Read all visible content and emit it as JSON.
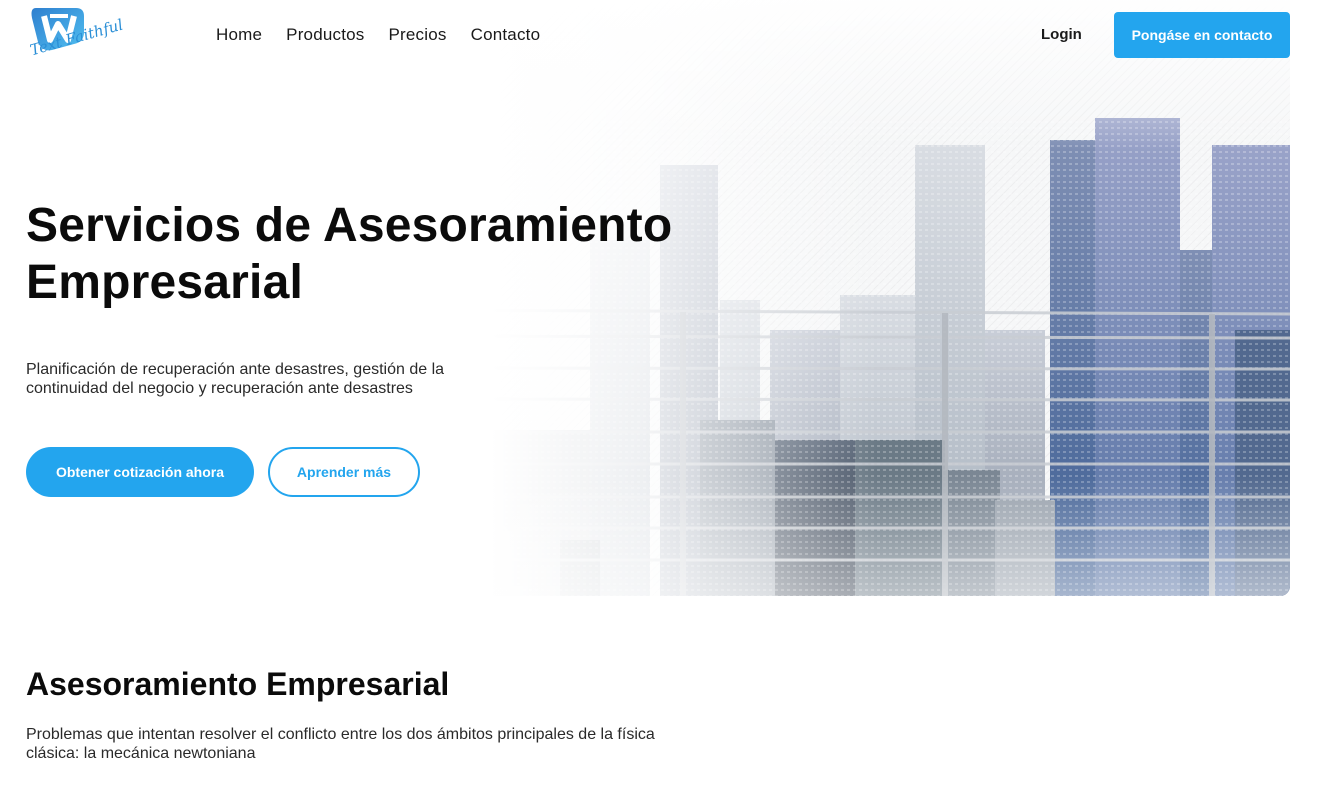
{
  "brand": {
    "logo_text": "Text Faithful",
    "accent_color": "#23a5ee"
  },
  "nav": {
    "items": [
      {
        "label": "Home"
      },
      {
        "label": "Productos"
      },
      {
        "label": "Precios"
      },
      {
        "label": "Contacto"
      }
    ],
    "login_label": "Login",
    "contact_button": "Pongáse en contacto"
  },
  "hero": {
    "title_line1": "Servicios de Asesoramiento",
    "title_line2": "Empresarial",
    "subtitle": "Planificación de recuperación ante desastres, gestión de la continuidad del negocio y recuperación ante desastres",
    "primary_button": "Obtener cotización ahora",
    "secondary_button": "Aprender más",
    "background_image": "city-skyline-behind-railing"
  },
  "section": {
    "title": "Asesoramiento Empresarial",
    "text": "Problemas que intentan resolver el conflicto entre los dos ámbitos principales de la física clásica: la mecánica newtoniana"
  }
}
